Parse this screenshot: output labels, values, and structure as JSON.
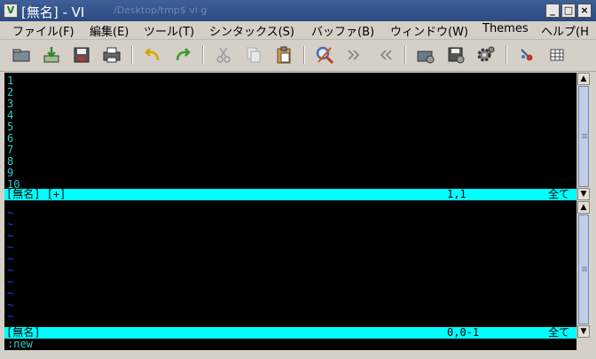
{
  "window": {
    "icon": "vim-icon",
    "title": "[無名] - VI",
    "background_path": "/Desktop/tmp$ vi  g"
  },
  "menubar": [
    {
      "id": "file",
      "label": "ファイル(F)"
    },
    {
      "id": "edit",
      "label": "編集(E)"
    },
    {
      "id": "tools",
      "label": "ツール(T)"
    },
    {
      "id": "syntax",
      "label": "シンタックス(S)"
    },
    {
      "id": "buffers",
      "label": "バッファ(B)"
    },
    {
      "id": "window",
      "label": "ウィンドウ(W)"
    },
    {
      "id": "themes",
      "label": "Themes"
    },
    {
      "id": "help",
      "label": "ヘルプ(H"
    }
  ],
  "toolbar": [
    {
      "id": "open",
      "icon": "folder-open-icon"
    },
    {
      "id": "save",
      "icon": "save-download-icon"
    },
    {
      "id": "save-all",
      "icon": "floppy-icon"
    },
    {
      "id": "print",
      "icon": "printer-icon"
    },
    {
      "id": "undo",
      "icon": "undo-icon"
    },
    {
      "id": "redo",
      "icon": "redo-icon"
    },
    {
      "id": "cut",
      "icon": "scissors-icon"
    },
    {
      "id": "copy",
      "icon": "copy-icon"
    },
    {
      "id": "paste",
      "icon": "paste-icon"
    },
    {
      "id": "replace",
      "icon": "find-replace-icon"
    },
    {
      "id": "find-next",
      "icon": "find-next-icon"
    },
    {
      "id": "find-prev",
      "icon": "find-prev-icon"
    },
    {
      "id": "load-session",
      "icon": "load-session-icon"
    },
    {
      "id": "save-session",
      "icon": "save-session-icon"
    },
    {
      "id": "run-script",
      "icon": "gear-icon"
    },
    {
      "id": "make",
      "icon": "make-icon"
    },
    {
      "id": "tags",
      "icon": "tags-table-icon"
    }
  ],
  "editor": {
    "top_lines": [
      "1",
      "2",
      "3",
      "4",
      "5",
      "6",
      "7",
      "8",
      "9",
      "10"
    ],
    "top_status": {
      "name": "[無名] [+]",
      "pos": "1,1",
      "all": "全て"
    },
    "bottom_tilde": "~",
    "bottom_status": {
      "name": "[無名]",
      "pos": "0,0-1",
      "all": "全て"
    },
    "command": ":new"
  },
  "colors": {
    "line_number": "#33cccc",
    "tilde": "#3333ff",
    "status_bg": "#00ffff",
    "title_bg": "#2f4f8a"
  }
}
